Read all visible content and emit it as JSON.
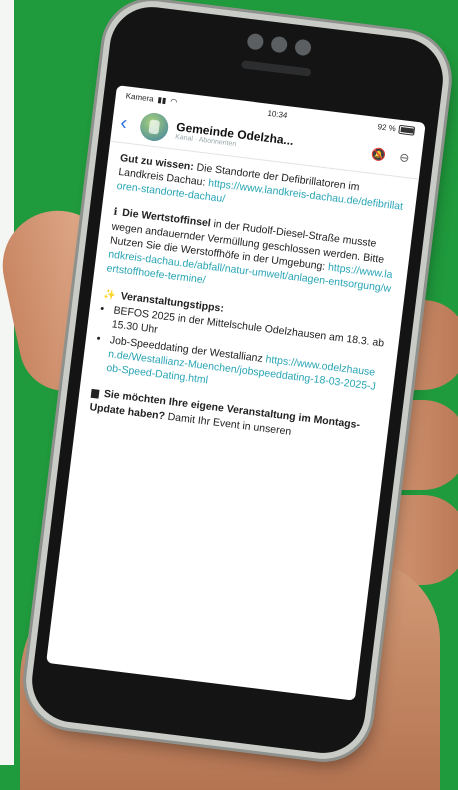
{
  "status": {
    "carrier": "Kamera",
    "time": "10:34",
    "battery": "92 %"
  },
  "chat": {
    "title": "Gemeinde Odelzha...",
    "subtitle": "Kanal · Abonnenten"
  },
  "messages": {
    "p1_bold": "Gut zu wissen:",
    "p1_text": "Die Standorte der Defibrillatoren im Landkreis Dachau:",
    "p1_link": "https://www.landkreis-dachau.de/defibrillatoren-standorte-dachau/",
    "p2_icon": "ℹ",
    "p2_bold": "Die Wertstoffinsel",
    "p2_text": "in der Rudolf-Diesel-Straße musste wegen andauernder Vermüllung geschlossen werden. Bitte Nutzen Sie die Werstoffhöfe in der Umgebung:",
    "p2_link": "https://www.landkreis-dachau.de/abfall/natur-umwelt/anlagen-entsorgung/wertstoffhoefe-termine/",
    "p3_icon": "✨",
    "p3_bold": "Veranstaltungstipps:",
    "p3_items": [
      "BEFOS 2025 in der Mittelschule Odelzhausen am 18.3. ab 15.30 Uhr",
      "Job-Speeddating der Westallianz"
    ],
    "p3_link": "https://www.odelzhausen.de/Westallianz-Muenchen/jobspeeddating-18-03-2025-Job-Speed-Dating.html",
    "p4_icon": "▆",
    "p4_bold": "Sie möchten Ihre eigene Veranstaltung im Montags-Update haben?",
    "p4_text": "Damit Ihr Event in unseren"
  }
}
